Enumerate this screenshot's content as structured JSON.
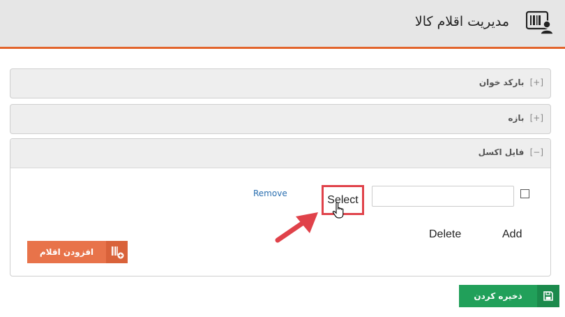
{
  "header": {
    "title": "مدیریت اقلام کالا",
    "icon": "barcode-user-icon"
  },
  "panels": [
    {
      "toggle": "[+]",
      "title": "بارکد خوان"
    },
    {
      "toggle": "[+]",
      "title": "بازه"
    },
    {
      "toggle": "[−]",
      "title": "فایل اکسل"
    }
  ],
  "excel_panel": {
    "remove_label": "Remove",
    "select_label": "Select",
    "input_value": "",
    "delete_label": "Delete",
    "add_label": "Add",
    "add_items_label": "افزودن اقلام"
  },
  "save_label": "ذخیره کردن",
  "colors": {
    "accent": "#e2642c",
    "add_button": "#e8734a",
    "save_button": "#21a05a",
    "highlight": "#e0424a",
    "link": "#2a6fb0"
  }
}
